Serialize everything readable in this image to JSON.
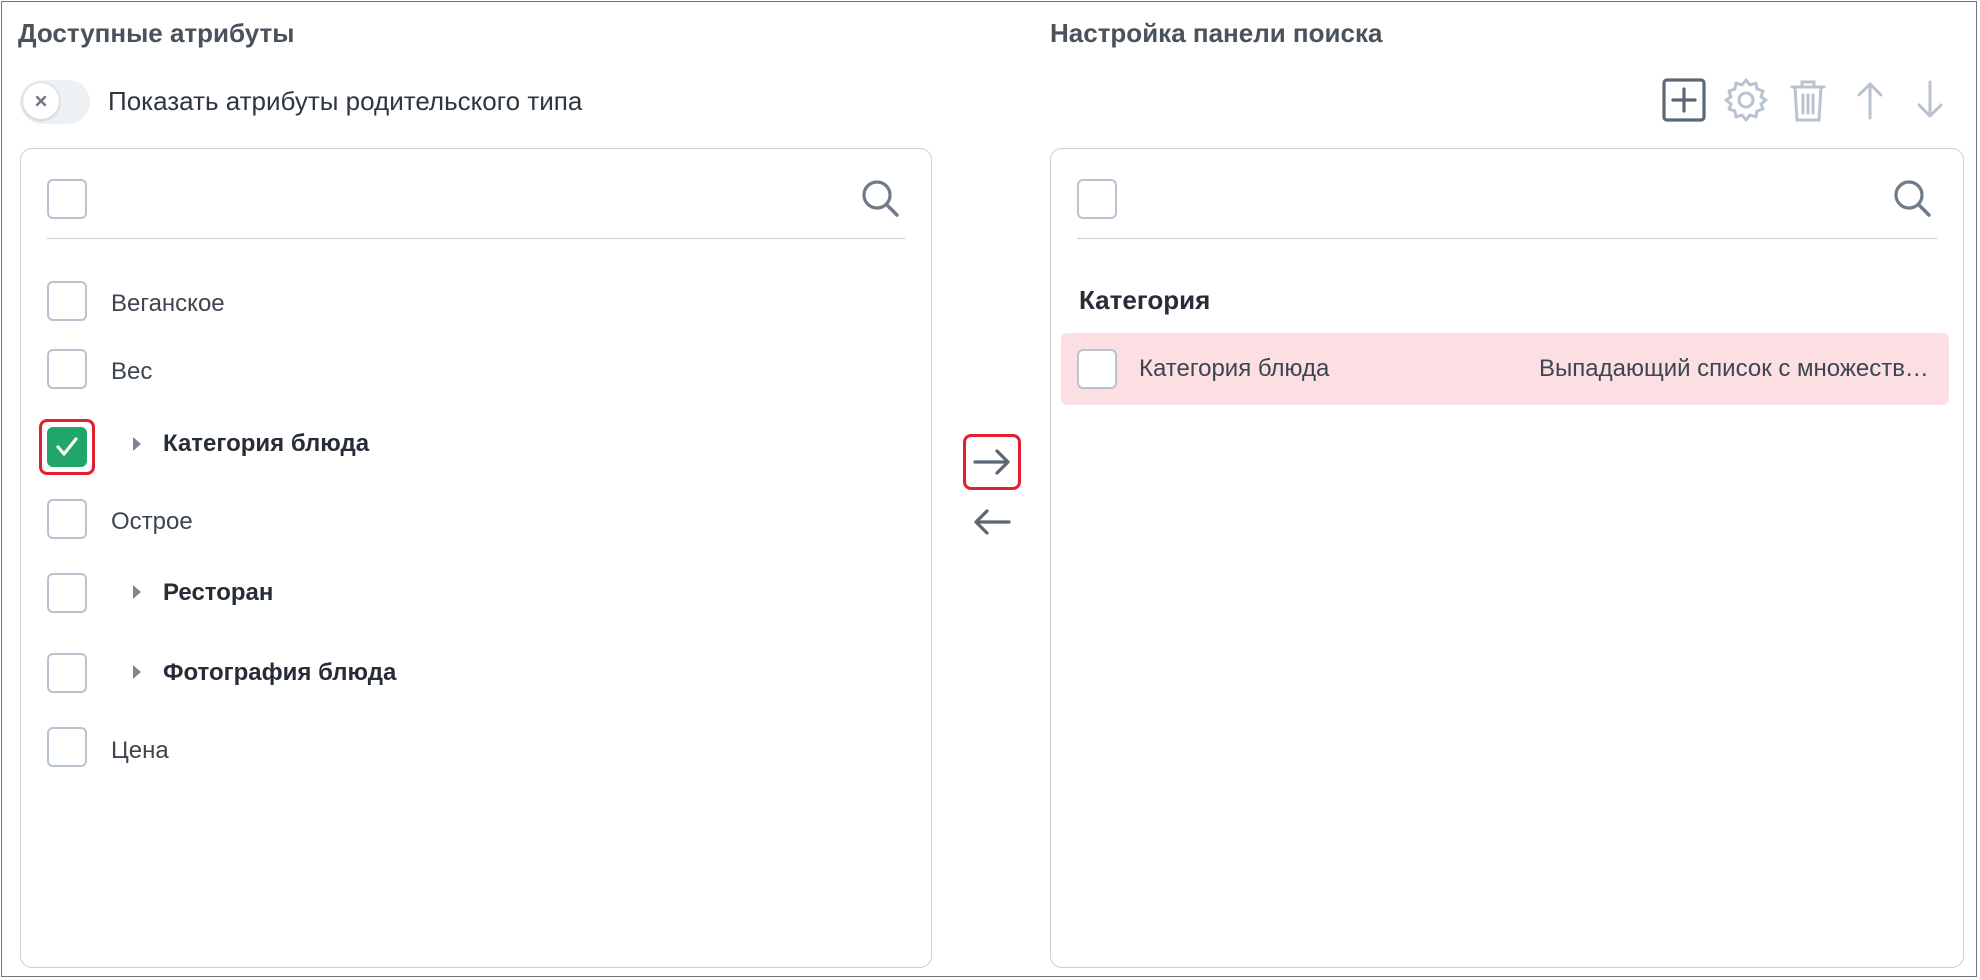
{
  "left": {
    "title": "Доступные атрибуты",
    "toggle_label": "Показать атрибуты родительского типа",
    "items": [
      {
        "label": "Веганское",
        "checked": false,
        "group": false
      },
      {
        "label": "Вес",
        "checked": false,
        "group": false
      },
      {
        "label": "Категория блюда",
        "checked": true,
        "group": true
      },
      {
        "label": "Острое",
        "checked": false,
        "group": false
      },
      {
        "label": "Ресторан",
        "checked": false,
        "group": true
      },
      {
        "label": "Фотография блюда",
        "checked": false,
        "group": true
      },
      {
        "label": "Цена",
        "checked": false,
        "group": false
      }
    ]
  },
  "right": {
    "title": "Настройка панели поиска",
    "group_title": "Категория",
    "rows": [
      {
        "label": "Категория блюда",
        "type": "Выпадающий список с множественным выбором"
      }
    ]
  },
  "toolbar": {
    "icons": [
      "add-icon",
      "gear-icon",
      "trash-icon",
      "arrow-up-icon",
      "arrow-down-icon"
    ]
  },
  "colors": {
    "accent_green": "#21a66a",
    "highlight_red": "#e0202f",
    "row_highlight": "#fcdfe3",
    "icon_gray": "#b8c3cf",
    "icon_dark": "#5b6775"
  }
}
